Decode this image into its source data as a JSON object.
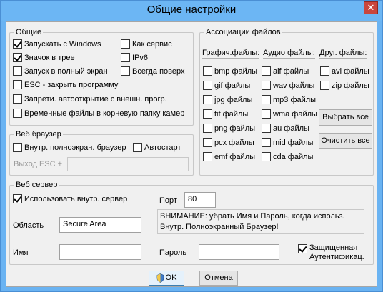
{
  "window": {
    "title": "Общие настройки",
    "close_glyph": "✕"
  },
  "general": {
    "title": "Общие",
    "start_with_windows": "Запускать с Windows",
    "tray_icon": "Значок в трее",
    "fullscreen_start": "Запуск в полный экран",
    "esc_close": "ESC - закрыть программу",
    "forbid_autoopen": "Запрети. автооткрытие с внешн. прогр.",
    "temp_files": "Временные файлы в корневую папку камер",
    "as_service": "Как сервис",
    "ipv6": "IPv6",
    "always_on_top": "Всегда поверх"
  },
  "browser": {
    "title": "Веб браузер",
    "internal_fullscreen": "Внутр. полноэкран. браузер",
    "autostart": "Автостарт",
    "esc_exit_label": "Выход ESC +",
    "esc_exit_value": ""
  },
  "assoc": {
    "title": "Ассоциации файлов",
    "col_graphics": "Графич.файлы:",
    "col_audio": "Аудио файлы:",
    "col_other": "Друг. файлы:",
    "graphics": [
      "bmp файлы",
      "gif файлы",
      "jpg файлы",
      "tif файлы",
      "png файлы",
      "pcx файлы",
      "emf файлы"
    ],
    "audio": [
      "aif файлы",
      "wav файлы",
      "mp3 файлы",
      "wma файлы",
      "au файлы",
      "mid файлы",
      "cda файлы"
    ],
    "other": [
      "avi файлы",
      "zip файлы"
    ],
    "select_all": "Выбрать все",
    "clear_all": "Очистить все"
  },
  "server": {
    "title": "Веб сервер",
    "use_internal": "Использовать внутр. сервер",
    "port_label": "Порт",
    "port_value": "80",
    "area_label": "Область",
    "area_value": "Secure Area",
    "warning": "ВНИМАНИЕ: убрать Имя и Пароль, когда использ. Внутр. Полноэкранный Браузер!",
    "name_label": "Имя",
    "name_value": "",
    "password_label": "Пароль",
    "password_value": "",
    "secure_auth": "Защищенная Аутентификац."
  },
  "footer": {
    "ok": "OK",
    "cancel": "Отмена"
  }
}
